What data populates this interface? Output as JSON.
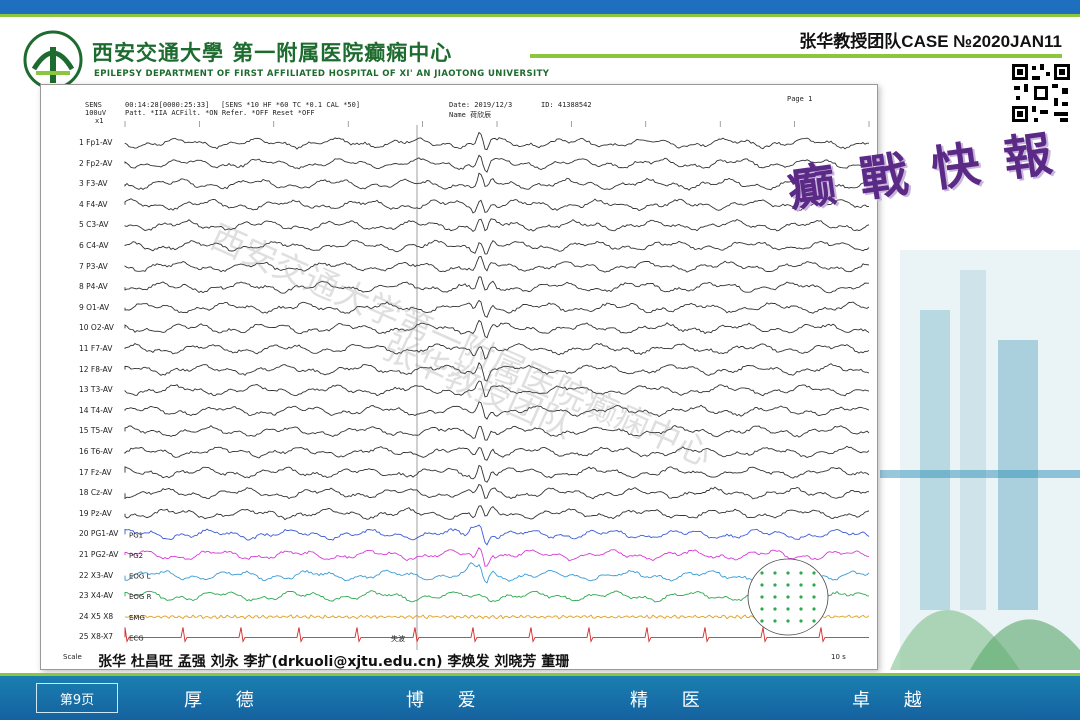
{
  "header": {
    "university_cn": "西安交通大學 第一附属医院癫痫中心",
    "university_en": "EPILEPSY DEPARTMENT OF FIRST AFFILIATED HOSPITAL OF XI' AN JIAOTONG UNIVERSITY",
    "case_title": "张华教授团队CASE №2020JAN11",
    "badge_text": "癫 戰 快 報"
  },
  "eeg": {
    "sens": "SENS",
    "scale1": "100uV",
    "scale2": "x1",
    "time": "00:14:28[0000:25:33]",
    "settings": "[SENS *10  HF *60  TC *0.1  CAL *50]",
    "settings2": "Patt. *IIA  ACFilt. *ON  Refer. *OFF  Reset *OFF",
    "date": "Date:  2019/12/3",
    "id": "ID:   41388542",
    "name": "Name  荷欣辰",
    "page": "Page          1",
    "channels": [
      "1  Fp1-AV",
      "2  Fp2-AV",
      "3  F3-AV",
      "4  F4-AV",
      "5  C3-AV",
      "6  C4-AV",
      "7  P3-AV",
      "8  P4-AV",
      "9  O1-AV",
      "10  O2-AV",
      "11  F7-AV",
      "12  F8-AV",
      "13  T3-AV",
      "14  T4-AV",
      "15  T5-AV",
      "16  T6-AV",
      "17  Fz-AV",
      "18  Cz-AV",
      "19  Pz-AV",
      "20  PG1-AV",
      "21  PG2-AV",
      "22  X3-AV",
      "23  X4-AV",
      "24  X5 X8",
      "25  X8-X7"
    ],
    "aux_labels": [
      "PG1",
      "PG2",
      "EOG L",
      "EOG R",
      "EMG",
      "ECG"
    ],
    "marker": "失波",
    "scale_label": "Scale",
    "time_end": "10 s",
    "trace_colors": {
      "eeg": "#333333",
      "pg": "#3b5bd6",
      "pg2": "#d63bd6",
      "eog_l": "#3b9bd6",
      "eog_r": "#2fa84f",
      "emg": "#e0a020",
      "ecg": "#d62a2a"
    }
  },
  "watermark": {
    "line1": "西安交通大学第一附属医院癫痫中心",
    "line2": "张华教授团队"
  },
  "authors": "张华  杜昌旺  孟强  刘永  李扩(drkuoli@xjtu.edu.cn)  李焕发  刘晓芳  董珊",
  "footer": {
    "page": "第9页",
    "mottos": [
      "厚 德",
      "博 爱",
      "精 医",
      "卓 越"
    ]
  }
}
